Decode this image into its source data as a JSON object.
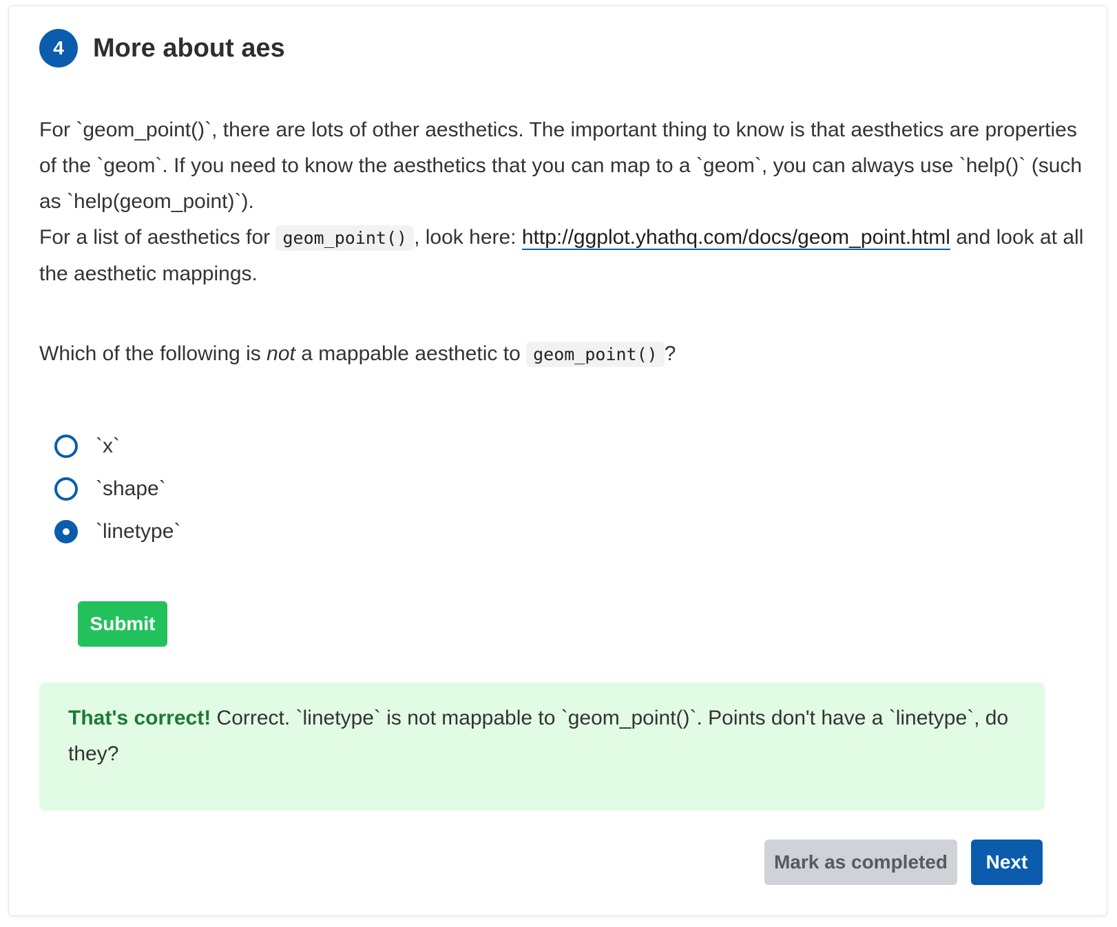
{
  "section": {
    "number": "4",
    "title": "More about aes"
  },
  "prose": {
    "p1": "For `geom_point()`, there are lots of other aesthetics. The important thing to know is that aesthetics are properties of the `geom`. If you need to know the aesthetics that you can map to a `geom`, you can always use `help()` (such as `help(geom_point)`).",
    "p2_before": "For a list of aesthetics for ",
    "p2_code": "geom_point()",
    "p2_middle": ", look here: ",
    "p2_link": "http://ggplot.yhathq.com/docs/geom_point.html",
    "p2_after": " and look at all the aesthetic mappings."
  },
  "question": {
    "before": "Which of the following is ",
    "emphasis": "not",
    "middle": " a mappable aesthetic to ",
    "code": "geom_point()",
    "after": "?"
  },
  "options": [
    {
      "label": "`x`",
      "selected": false
    },
    {
      "label": "`shape`",
      "selected": false
    },
    {
      "label": "`linetype`",
      "selected": true
    }
  ],
  "submit_label": "Submit",
  "feedback": {
    "status": "That's correct!",
    "message": " Correct. `linetype` is not mappable to `geom_point()`. Points don't have a `linetype`, do they?"
  },
  "footer": {
    "mark_label": "Mark as completed",
    "next_label": "Next"
  },
  "colors": {
    "accent": "#0b5cad",
    "submit": "#23c15b",
    "success_bg": "#e2fbe5",
    "success_text": "#1c7a33",
    "disabled_btn": "#cfd2d6"
  }
}
